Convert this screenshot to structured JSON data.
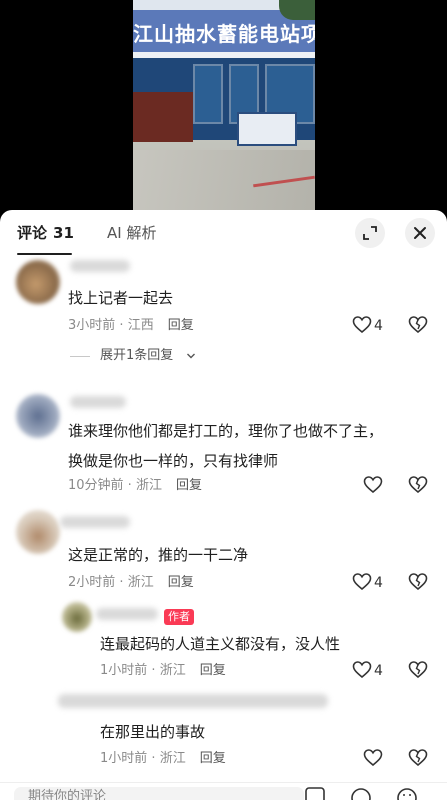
{
  "video": {
    "sign_text": "江山抽水蓄能电站项目经"
  },
  "sheet": {
    "tabs": [
      {
        "label": "评论",
        "count": "31"
      },
      {
        "label": "AI 解析"
      }
    ]
  },
  "comments": [
    {
      "text": "找上记者一起去",
      "time": "3小时前",
      "location": "江西",
      "reply": "回复",
      "likes": "4",
      "expand": "展开1条回复"
    },
    {
      "text_line1": "谁来理你他们都是打工的，理你了也做不了主，",
      "text_line2": "换做是你也一样的，只有找律师",
      "time": "10分钟前",
      "location": "浙江",
      "reply": "回复"
    },
    {
      "text": "这是正常的，推的一干二净",
      "time": "2小时前",
      "location": "浙江",
      "reply": "回复",
      "likes": "4"
    },
    {
      "text": "连最起码的人道主义都没有，没人性",
      "badge": "作者",
      "time": "1小时前",
      "location": "浙江",
      "reply": "回复",
      "likes": "4"
    },
    {
      "text": "在那里出的事故",
      "time": "1小时前",
      "location": "浙江",
      "reply": "回复"
    }
  ],
  "input": {
    "placeholder": "期待你的评论"
  },
  "colors": {
    "author_badge": "#fa3a55",
    "text": "#1f1f1f",
    "meta": "#8a8a8a"
  }
}
